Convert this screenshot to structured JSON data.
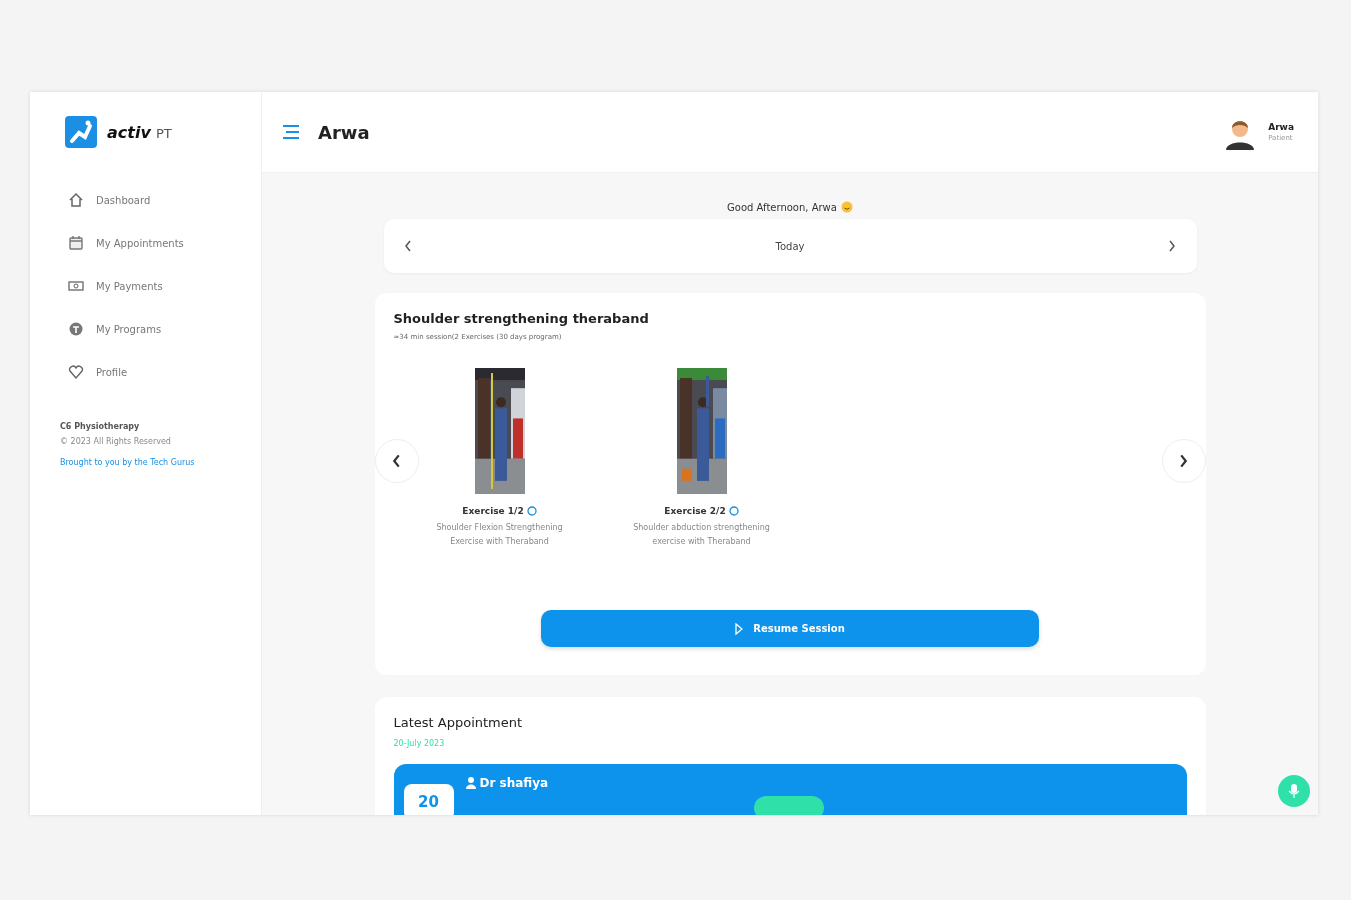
{
  "brand": {
    "name": "activ",
    "suffix": "PT"
  },
  "sidebar": {
    "items": [
      {
        "label": "Dashboard",
        "kind": "home",
        "selected": false
      },
      {
        "label": "My Appointments",
        "kind": "calendar",
        "selected": false
      },
      {
        "label": "My Payments",
        "kind": "payment",
        "selected": false
      },
      {
        "label": "My Programs",
        "kind": "program",
        "selected": false
      },
      {
        "label": "Profile",
        "kind": "heart",
        "selected": false
      }
    ],
    "company": "C6 Physiotherapy",
    "copyright": "© 2023 All Rights Reserved",
    "credit": "Brought to you by the Tech Gurus"
  },
  "header": {
    "title": "Arwa",
    "user_name": "Arwa",
    "user_role": "Patient"
  },
  "greeting": "Good Afternoon, Arwa",
  "date_nav": {
    "label": "Today"
  },
  "program": {
    "title": "Shoulder strengthening theraband",
    "subtitle": "≈34 min session(2 Exercises (30 days program)",
    "exercises": [
      {
        "label": "Exercise 1/2",
        "description": "Shoulder Flexion Strengthening Exercise with Theraband",
        "kind": "picture"
      },
      {
        "label": "Exercise 2/2",
        "description": "Shoulder abduction strengthening exercise with Theraband",
        "kind": "picture"
      }
    ],
    "button": "Resume Session"
  },
  "appointment": {
    "title": "Latest Appointment",
    "date": "20-July 2023",
    "day": "20",
    "doctor": "Dr shafiya"
  }
}
